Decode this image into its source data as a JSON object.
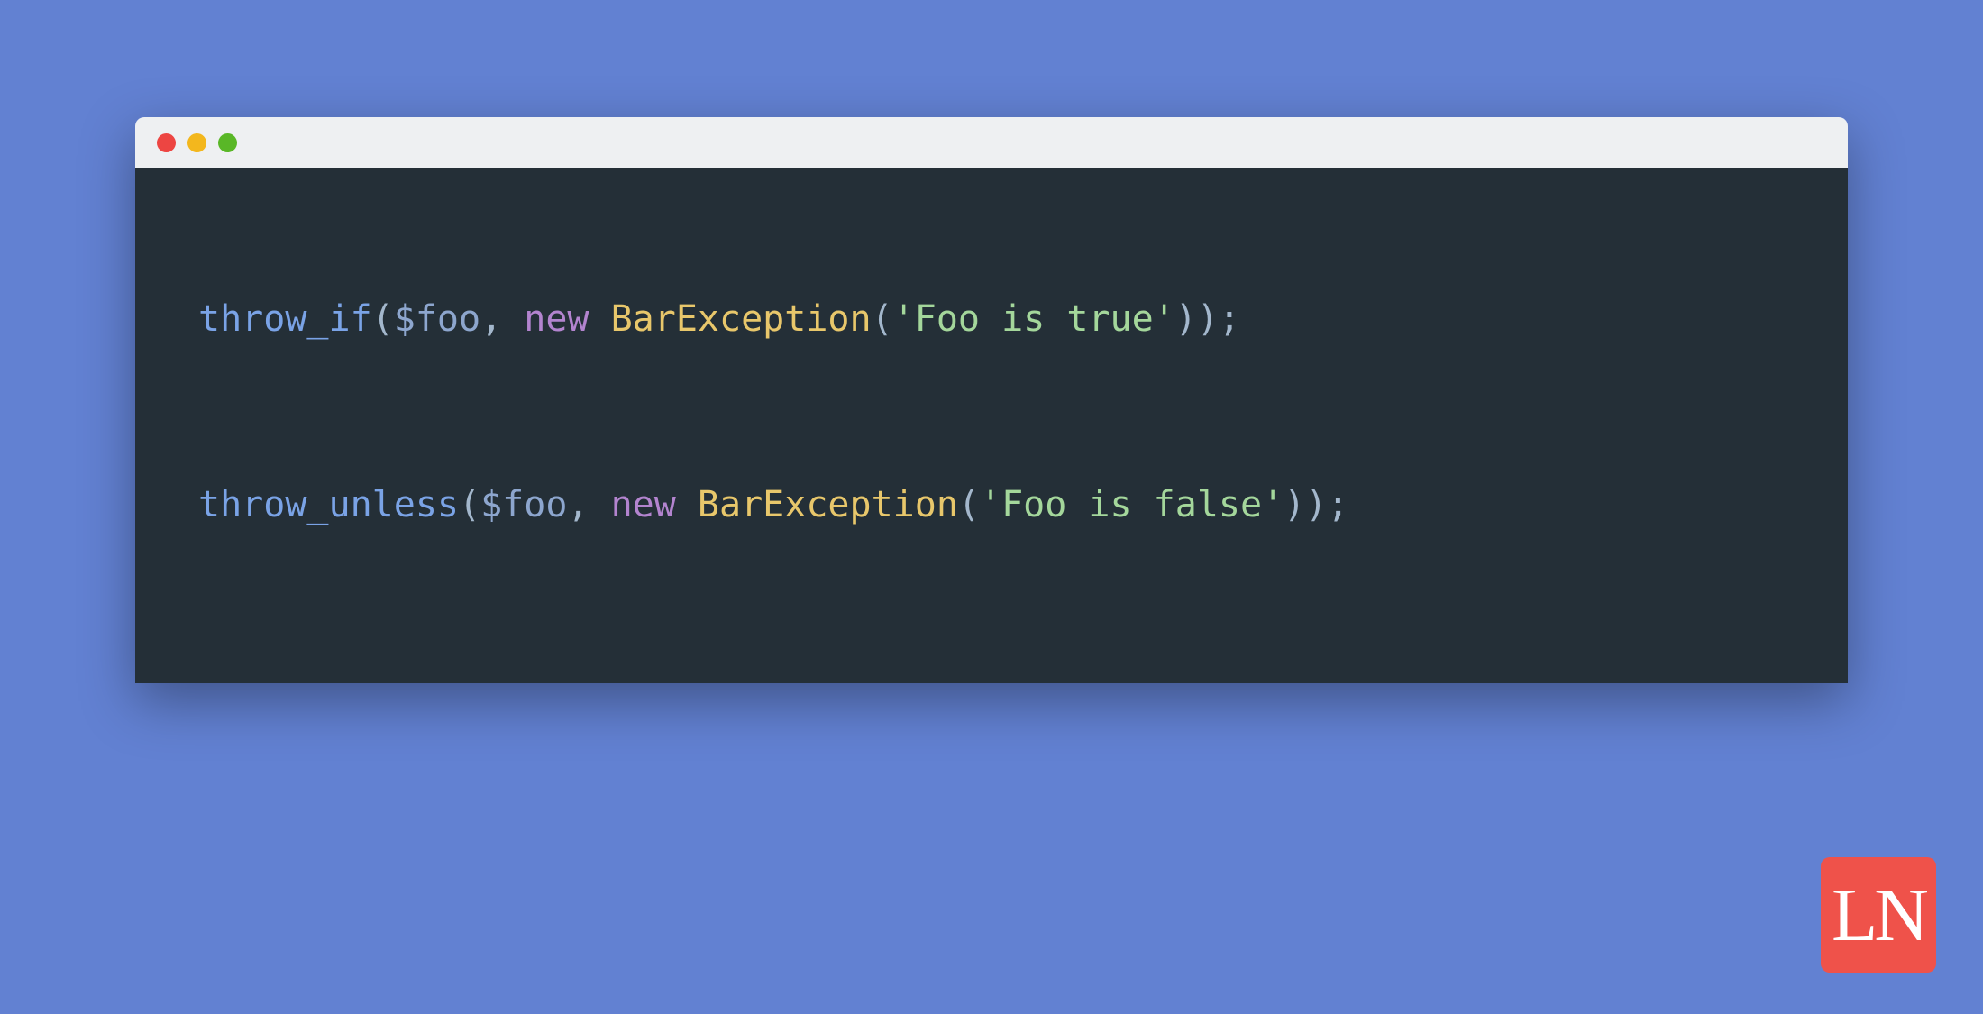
{
  "colors": {
    "background": "#6281d2",
    "editor_bg": "#242f37",
    "titlebar_bg": "#eef0f2",
    "traffic_red": "#ed4542",
    "traffic_yellow": "#f3b71d",
    "traffic_green": "#59b727",
    "logo_bg": "#ef524a"
  },
  "code": {
    "line1": {
      "func": "throw_if",
      "open": "(",
      "var": "$foo",
      "comma": ", ",
      "kw": "new",
      "space": " ",
      "class": "BarException",
      "open2": "(",
      "string": "'Foo is true'",
      "close": "));"
    },
    "line2": {
      "func": "throw_unless",
      "open": "(",
      "var": "$foo",
      "comma": ", ",
      "kw": "new",
      "space": " ",
      "class": "BarException",
      "open2": "(",
      "string": "'Foo is false'",
      "close": "));"
    }
  },
  "logo": {
    "text": "LN"
  }
}
